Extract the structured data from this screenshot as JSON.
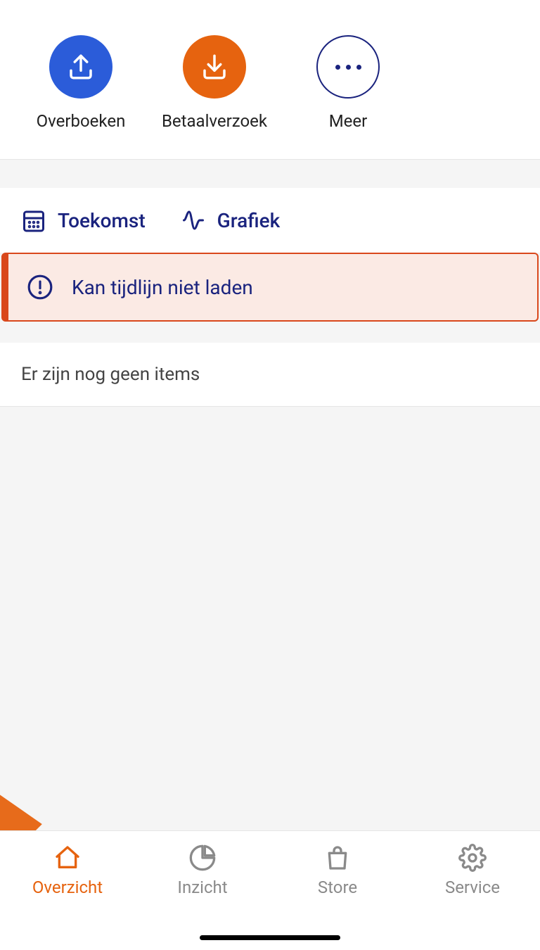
{
  "actions": {
    "transfer": {
      "label": "Overboeken"
    },
    "payment_request": {
      "label": "Betaalverzoek"
    },
    "more": {
      "label": "Meer"
    }
  },
  "tabs": {
    "future": {
      "label": "Toekomst"
    },
    "graph": {
      "label": "Grafiek"
    }
  },
  "error": {
    "message": "Kan tijdlijn niet laden"
  },
  "empty": {
    "message": "Er zijn nog geen items"
  },
  "nav": {
    "overview": {
      "label": "Overzicht"
    },
    "insight": {
      "label": "Inzicht"
    },
    "store": {
      "label": "Store"
    },
    "service": {
      "label": "Service"
    }
  },
  "colors": {
    "blue": "#2b5cd9",
    "orange": "#e6630f",
    "navy": "#1a237e"
  }
}
